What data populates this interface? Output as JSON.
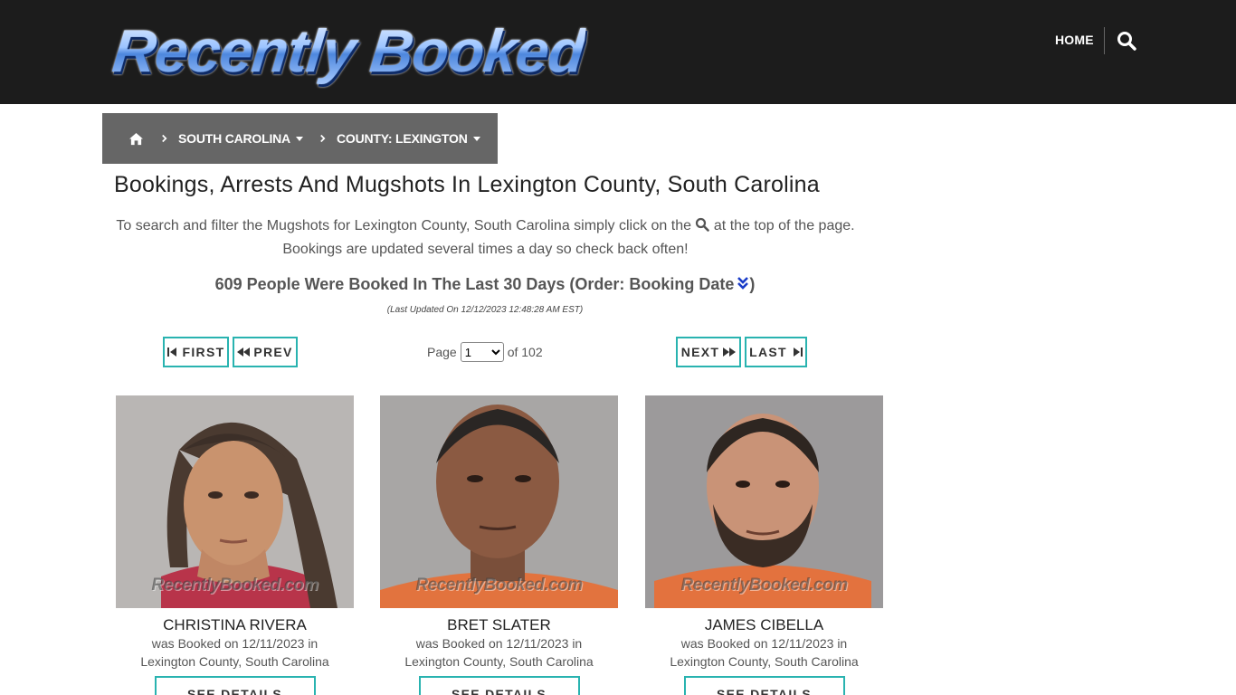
{
  "header": {
    "logo_text": "Recently Booked",
    "nav_home": "HOME",
    "search_icon": "search-icon"
  },
  "breadcrumb": {
    "home_icon": "home-icon",
    "state": "SOUTH CAROLINA",
    "county": "COUNTY: LEXINGTON"
  },
  "main": {
    "title": "Bookings, Arrests And Mugshots In Lexington County, South Carolina",
    "intro_before": "To search and filter the Mugshots for Lexington County, South Carolina simply click on the",
    "intro_after": "at the top of the page. Bookings are updated several times a day so check back often!",
    "count_text": "609 People Were Booked In The Last 30 Days (Order: Booking Date",
    "count_close": ")",
    "updated": "(Last Updated On 12/12/2023 12:48:28 AM EST)"
  },
  "pager": {
    "first": "FIRST",
    "prev": "PREV",
    "next": "NEXT",
    "last": "LAST",
    "page_label": "Page",
    "current_page": "1",
    "of_label": "of 102"
  },
  "watermark": "RecentlyBooked.com",
  "details_label": "SEE DETAILS",
  "cards": [
    {
      "name": "CHRISTINA RIVERA",
      "booked": "was Booked on 12/11/2023 in",
      "location": "Lexington County, South Carolina"
    },
    {
      "name": "BRET SLATER",
      "booked": "was Booked on 12/11/2023 in",
      "location": "Lexington County, South Carolina"
    },
    {
      "name": "JAMES CIBELLA",
      "booked": "was Booked on 12/11/2023 in",
      "location": "Lexington County, South Carolina"
    }
  ],
  "colors": {
    "header_bg": "#1c1c1c",
    "breadcrumb_bg": "#666666",
    "accent": "#29b3b0",
    "order_icon": "#1a3cc8"
  }
}
